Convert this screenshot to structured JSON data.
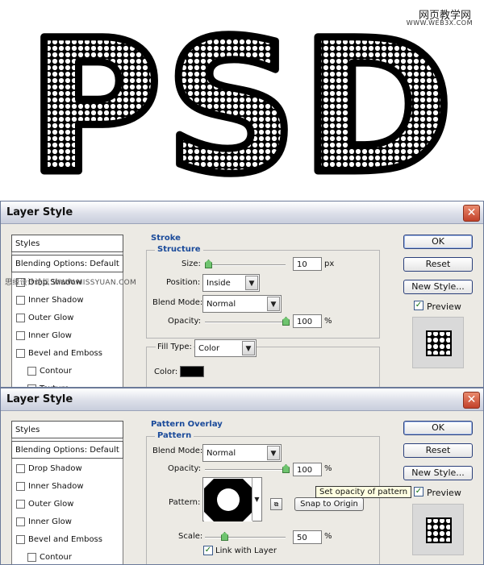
{
  "artwork": {
    "text": "PSD",
    "watermark_title": "网页教学网",
    "watermark_url": "WWW.WEB3X.COM"
  },
  "mid_watermark": "思缘设计论坛 WWW.MISSYUAN.COM",
  "dialog1": {
    "title": "Layer Style",
    "close_glyph": "✕",
    "styles_header": "Styles",
    "blending_options": "Blending Options: Default",
    "items": [
      {
        "label": "Drop Shadow",
        "checked": false,
        "indent": false
      },
      {
        "label": "Inner Shadow",
        "checked": false,
        "indent": false
      },
      {
        "label": "Outer Glow",
        "checked": false,
        "indent": false
      },
      {
        "label": "Inner Glow",
        "checked": false,
        "indent": false
      },
      {
        "label": "Bevel and Emboss",
        "checked": false,
        "indent": false
      },
      {
        "label": "Contour",
        "checked": false,
        "indent": true
      },
      {
        "label": "Texture",
        "checked": false,
        "indent": true
      }
    ],
    "section_title": "Stroke",
    "group_title": "Structure",
    "size_label": "Size:",
    "size_value": "10",
    "size_unit": "px",
    "size_slider_fraction": 0.04,
    "position_label": "Position:",
    "position_value": "Inside",
    "blend_mode_label": "Blend Mode:",
    "blend_mode_value": "Normal",
    "opacity_label": "Opacity:",
    "opacity_value": "100",
    "opacity_unit": "%",
    "opacity_slider_fraction": 1.0,
    "fill_type_label": "Fill Type:",
    "fill_type_value": "Color",
    "color_label": "Color:",
    "color_swatch": "#000000",
    "buttons": {
      "ok": "OK",
      "reset": "Reset",
      "new_style": "New Style..."
    },
    "preview_label": "Preview",
    "preview_checked": true
  },
  "dialog2": {
    "title": "Layer Style",
    "close_glyph": "✕",
    "styles_header": "Styles",
    "blending_options": "Blending Options: Default",
    "items": [
      {
        "label": "Drop Shadow",
        "checked": false,
        "indent": false
      },
      {
        "label": "Inner Shadow",
        "checked": false,
        "indent": false
      },
      {
        "label": "Outer Glow",
        "checked": false,
        "indent": false
      },
      {
        "label": "Inner Glow",
        "checked": false,
        "indent": false
      },
      {
        "label": "Bevel and Emboss",
        "checked": false,
        "indent": false
      },
      {
        "label": "Contour",
        "checked": false,
        "indent": true
      }
    ],
    "section_title": "Pattern Overlay",
    "group_title": "Pattern",
    "blend_mode_label": "Blend Mode:",
    "blend_mode_value": "Normal",
    "opacity_label": "Opacity:",
    "opacity_value": "100",
    "opacity_unit": "%",
    "opacity_slider_fraction": 1.0,
    "pattern_label": "Pattern:",
    "snap_to_origin": "Snap to Origin",
    "tooltip": "Set opacity of pattern",
    "scale_label": "Scale:",
    "scale_value": "50",
    "scale_unit": "%",
    "scale_slider_fraction": 0.24,
    "link_with_layer": "Link with Layer",
    "link_checked": true,
    "buttons": {
      "ok": "OK",
      "reset": "Reset",
      "new_style": "New Style..."
    },
    "preview_label": "Preview",
    "preview_checked": true
  },
  "colors": {
    "accent_title": "#1a4a9a",
    "dialog_bg": "#eceae4",
    "close_red": "#c2412a"
  }
}
